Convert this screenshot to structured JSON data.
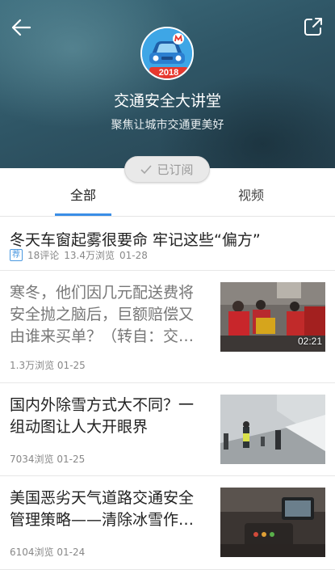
{
  "header": {
    "back_icon": "arrow-left-icon",
    "share_icon": "share-external-icon",
    "logo_year": "2018",
    "channel_title": "交通安全大讲堂",
    "channel_subtitle": "聚焦让城市交通更美好",
    "subscribe_label": "已订阅",
    "subscribe_icon": "check-icon"
  },
  "tabs": [
    {
      "label": "全部",
      "active": true
    },
    {
      "label": "视频",
      "active": false
    }
  ],
  "articles": [
    {
      "title": "冬天车窗起雾很要命 牢记这些“偏方”",
      "tag": "荐",
      "comments": "18评论",
      "views": "13.4万浏览",
      "date": "01-28"
    },
    {
      "title": "寒冬，他们因几元配送费将安全抛之脑后，巨额赔偿又由谁来买单？（转自：交…",
      "views": "1.3万浏览",
      "date": "01-25",
      "duration": "02:21",
      "read": true
    },
    {
      "title": "国内外除雪方式大不同？一组动图让人大开眼界",
      "views": "7034浏览",
      "date": "01-25"
    },
    {
      "title": "美国恶劣天气道路交通安全管理策略——清除冰雪作…",
      "views": "6104浏览",
      "date": "01-24"
    }
  ],
  "colors": {
    "accent": "#3a8ee6",
    "header_bg": "#2f5666",
    "badge_red": "#e7382e"
  }
}
